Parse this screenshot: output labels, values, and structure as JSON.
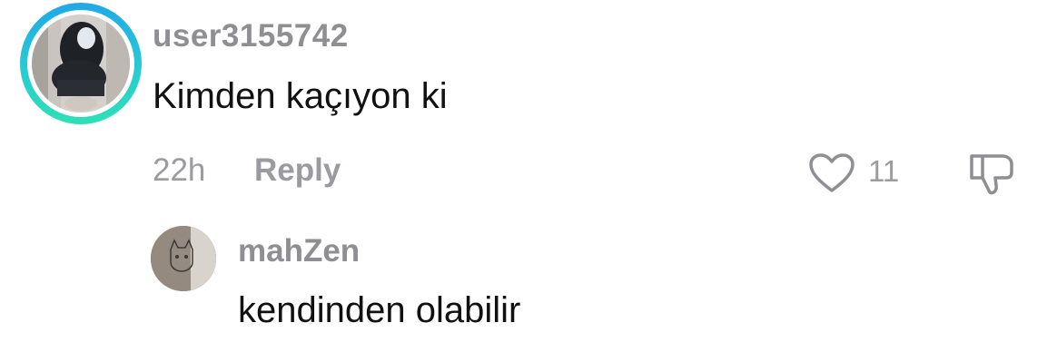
{
  "comment": {
    "username": "user3155742",
    "text": "Kimden kaçıyon ki",
    "time": "22h",
    "reply_label": "Reply",
    "like_count": "11",
    "avatar_ring_color": "#25c9d6"
  },
  "reply": {
    "username": "mahZen",
    "text": "kendinden olabilir"
  },
  "icons": {
    "like": "heart-outline-icon",
    "dislike": "thumbs-down-outline-icon"
  },
  "colors": {
    "meta_text": "#9a9aa0",
    "username": "#8e8e93",
    "body_text": "#111111"
  }
}
